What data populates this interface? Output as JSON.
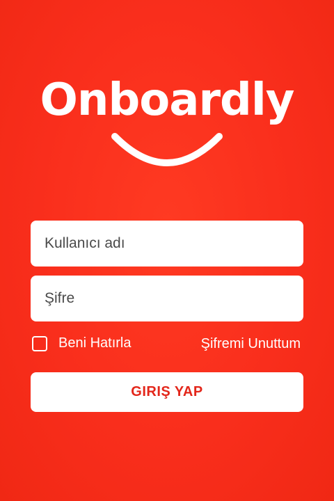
{
  "brand": {
    "name": "Onboardly",
    "primary_color": "#f92e1c",
    "accent_text_color": "#e3261a"
  },
  "login_form": {
    "username_placeholder": "Kullanıcı adı",
    "password_placeholder": "Şifre",
    "remember_me_label": "Beni Hatırla",
    "remember_me_checked": false,
    "forgot_password_label": "Şifremi Unuttum",
    "submit_label": "GIRIŞ YAP"
  },
  "icons": {
    "smile": "smile-icon",
    "checkbox": "checkbox-icon"
  }
}
